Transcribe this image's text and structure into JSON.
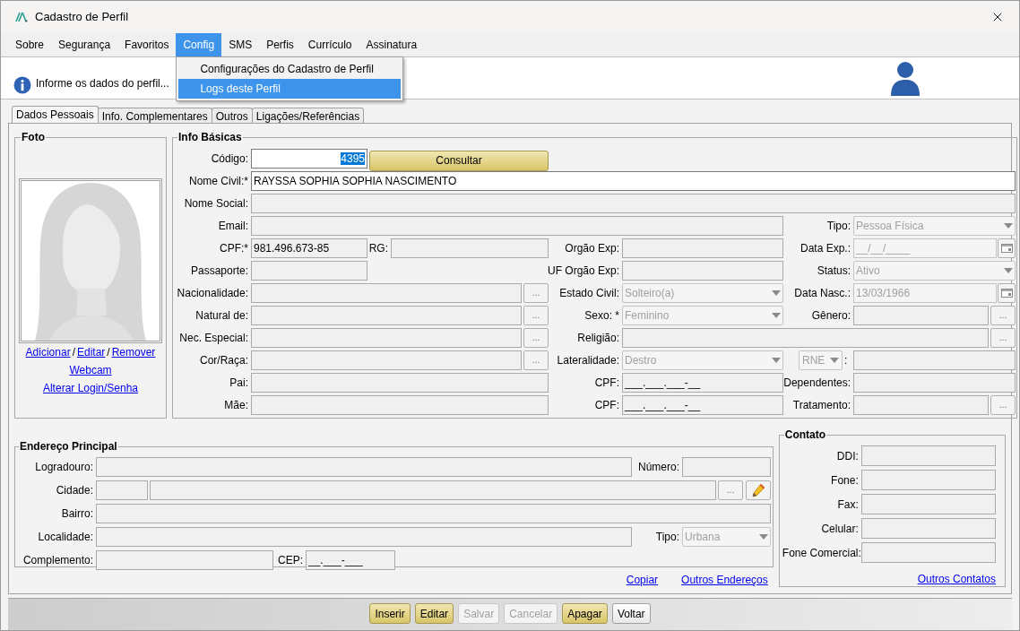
{
  "window": {
    "title": "Cadastro de Perfil"
  },
  "menu": [
    {
      "label": "Sobre",
      "selected": false
    },
    {
      "label": "Segurança",
      "selected": false
    },
    {
      "label": "Favoritos",
      "selected": false
    },
    {
      "label": "Config",
      "selected": true
    },
    {
      "label": "SMS",
      "selected": false
    },
    {
      "label": "Perfis",
      "selected": false
    },
    {
      "label": "Currículo",
      "selected": false
    },
    {
      "label": "Assinatura",
      "selected": false
    }
  ],
  "menu_dropdown": [
    {
      "label": "Configurações do Cadastro de Perfil",
      "selected": false
    },
    {
      "label": "Logs deste Perfil",
      "selected": true
    }
  ],
  "info_bar": {
    "message": "Informe os dados do perfil..."
  },
  "tabs": [
    {
      "label": "Dados Pessoais",
      "selected": true
    },
    {
      "label": "Info. Complementares",
      "selected": false
    },
    {
      "label": "Outros",
      "selected": false
    },
    {
      "label": "Ligações/Referências",
      "selected": false
    }
  ],
  "photo": {
    "title": "Foto",
    "links": [
      [
        {
          "kind": "link",
          "label": "Adicionar"
        },
        {
          "kind": "separator",
          "label": "/"
        },
        {
          "kind": "link",
          "label": "Editar"
        },
        {
          "kind": "separator",
          "label": "/"
        },
        {
          "kind": "link",
          "label": "Remover"
        }
      ],
      [
        {
          "kind": "link",
          "label": "Webcam"
        }
      ],
      [
        {
          "kind": "link",
          "label": "Alterar Login/Senha"
        }
      ]
    ]
  },
  "info_basicas": {
    "title": "Info Básicas",
    "rows": [
      [
        {
          "label": "Código:",
          "kind": "text",
          "editable": true,
          "disabled": false,
          "value": "4395",
          "highlighted": true
        },
        {
          "kind": "button",
          "label": "Consultar"
        }
      ],
      [
        {
          "label": "Nome Civil:*",
          "kind": "text",
          "editable": true,
          "disabled": false,
          "value": "RAYSSA SOPHIA SOPHIA NASCIMENTO"
        }
      ],
      [
        {
          "label": "Nome Social:",
          "kind": "text",
          "editable": false,
          "disabled": false
        }
      ],
      [
        {
          "label": "Email:",
          "kind": "text",
          "editable": false,
          "disabled": false
        },
        {
          "label": "Tipo:",
          "kind": "select",
          "editable": false,
          "disabled": true,
          "value": "Pessoa Física"
        }
      ],
      [
        {
          "label": "CPF:*",
          "kind": "text",
          "editable": false,
          "disabled": false,
          "value": "981.496.673-85"
        },
        {
          "label": "RG:",
          "kind": "text",
          "editable": false,
          "disabled": false
        },
        {
          "label": "Orgão Exp:",
          "kind": "text",
          "editable": false,
          "disabled": false
        },
        {
          "label": "Data Exp.:",
          "kind": "date",
          "editable": false,
          "disabled": true,
          "value": "__/__/____"
        }
      ],
      [
        {
          "label": "Passaporte:",
          "kind": "text",
          "editable": false,
          "disabled": false
        },
        {
          "label": "UF Orgão Exp:",
          "kind": "text",
          "editable": false,
          "disabled": false
        },
        {
          "label": "Status:",
          "kind": "select",
          "editable": false,
          "disabled": true,
          "value": "Ativo"
        }
      ],
      [
        {
          "label": "Nacionalidade:",
          "kind": "lookup",
          "editable": false,
          "disabled": false,
          "button_label": "..."
        },
        {
          "label": "Estado Civil:",
          "kind": "select",
          "editable": false,
          "disabled": true,
          "value": "Solteiro(a)"
        },
        {
          "label": "Data Nasc.:",
          "kind": "date",
          "editable": false,
          "disabled": true,
          "value": "13/03/1966"
        }
      ],
      [
        {
          "label": "Natural de:",
          "kind": "lookup",
          "editable": false,
          "disabled": false,
          "button_label": "..."
        },
        {
          "label": "Sexo: *",
          "kind": "select",
          "editable": false,
          "disabled": true,
          "value": "Feminino"
        },
        {
          "label": "Gênero:",
          "kind": "lookup",
          "editable": false,
          "disabled": false,
          "button_label": "..."
        }
      ],
      [
        {
          "label": "Nec. Especial:",
          "kind": "lookup",
          "editable": false,
          "disabled": false,
          "button_label": "..."
        },
        {
          "label": "Religião:",
          "kind": "lookup",
          "editable": false,
          "disabled": false,
          "button_label": "..."
        }
      ],
      [
        {
          "label": "Cor/Raça:",
          "kind": "lookup",
          "editable": false,
          "disabled": false,
          "button_label": "..."
        },
        {
          "label": "Lateralidade:",
          "kind": "select",
          "editable": false,
          "disabled": true,
          "value": "Destro"
        },
        {
          "label": ":",
          "kind": "doc_select",
          "editable": false,
          "disabled": true,
          "value": "RNE"
        },
        {
          "kind": "text",
          "editable": false,
          "disabled": false
        }
      ],
      [
        {
          "label": "Pai:",
          "kind": "text",
          "editable": false,
          "disabled": false
        },
        {
          "label": "CPF:",
          "kind": "text",
          "editable": false,
          "disabled": false,
          "value": "___.___.___-__"
        },
        {
          "label": "Dependentes:",
          "kind": "text",
          "editable": false,
          "disabled": false
        }
      ],
      [
        {
          "label": "Mãe:",
          "kind": "text",
          "editable": false,
          "disabled": false
        },
        {
          "label": "CPF:",
          "kind": "text",
          "editable": false,
          "disabled": false,
          "value": "___.___.___-__"
        },
        {
          "label": "Tratamento:",
          "kind": "lookup",
          "editable": false,
          "disabled": false,
          "button_label": "..."
        }
      ]
    ]
  },
  "endereco": {
    "title": "Endereço Principal",
    "rows": [
      [
        {
          "label": "Logradouro:",
          "kind": "text",
          "editable": false,
          "disabled": false
        },
        {
          "label": "Número:",
          "kind": "text",
          "editable": false,
          "disabled": false
        }
      ],
      [
        {
          "label": "Cidade:",
          "kind": "text",
          "editable": false,
          "disabled": false
        },
        {
          "kind": "lookup_edit",
          "editable": false,
          "disabled": false,
          "button_label": "..."
        }
      ],
      [
        {
          "label": "Bairro:",
          "kind": "text",
          "editable": false,
          "disabled": false
        }
      ],
      [
        {
          "label": "Localidade:",
          "kind": "text",
          "editable": false,
          "disabled": false
        },
        {
          "label": "Tipo:",
          "kind": "select",
          "editable": false,
          "disabled": true,
          "value": "Urbana"
        }
      ],
      [
        {
          "label": "Complemento:",
          "kind": "text",
          "editable": false,
          "disabled": false
        },
        {
          "label": "CEP:",
          "kind": "text",
          "editable": false,
          "disabled": false,
          "value": "__.___-___"
        }
      ]
    ],
    "links": [
      "Copiar",
      "Outros Endereços"
    ]
  },
  "contato": {
    "title": "Contato",
    "fields": [
      {
        "label": "DDI:",
        "editable": false,
        "disabled": false
      },
      {
        "label": "Fone:",
        "editable": false,
        "disabled": false
      },
      {
        "label": "Fax:",
        "editable": false,
        "disabled": false
      },
      {
        "label": "Celular:",
        "editable": false,
        "disabled": false
      },
      {
        "label": "Fone Comercial:",
        "editable": false,
        "disabled": false
      }
    ],
    "link": "Outros Contatos"
  },
  "buttons": [
    {
      "label": "Inserir",
      "kind": "gold",
      "disabled": false
    },
    {
      "label": "Editar",
      "kind": "gold",
      "disabled": false
    },
    {
      "label": "Salvar",
      "kind": "plain",
      "disabled": true
    },
    {
      "label": "Cancelar",
      "kind": "plain",
      "disabled": true
    },
    {
      "label": "Apagar",
      "kind": "gold",
      "disabled": false
    },
    {
      "label": "Voltar",
      "kind": "plain",
      "disabled": false
    }
  ]
}
